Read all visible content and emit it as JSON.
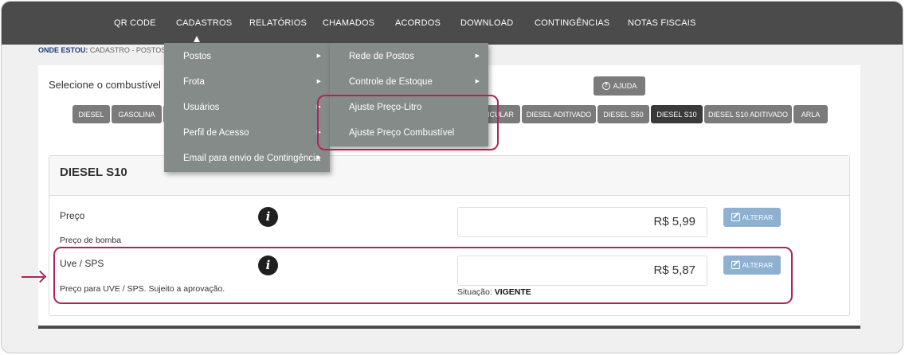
{
  "nav": {
    "items": [
      "QR CODE",
      "CADASTROS",
      "RELATÓRIOS",
      "CHAMADOS",
      "ACORDOS",
      "DOWNLOAD",
      "CONTINGÊNCIAS",
      "NOTAS FISCAIS"
    ]
  },
  "breadcrumb": {
    "label": "ONDE ESTOU:",
    "path": "CADASTRO - POSTOS"
  },
  "fuel_select": {
    "label": "Selecione o combustível c",
    "help_label": "AJUDA",
    "buttons": [
      "DIESEL",
      "GASOLINA",
      "",
      "ICULAR",
      "DIESEL ADITIVADO",
      "DIESEL S50",
      "DIESEL S10",
      "DIESEL S10 ADITIVADO",
      "ARLA"
    ],
    "selected": "DIESEL S10"
  },
  "card": {
    "title": "DIESEL S10",
    "rows": [
      {
        "label": "Preço",
        "description": "Preço de bomba",
        "value": "R$ 5,99",
        "button": "ALTERAR"
      },
      {
        "label": "Uve / SPS",
        "description": "Preço para UVE / SPS. Sujeito a aprovação.",
        "value": "R$ 5,87",
        "button": "ALTERAR"
      }
    ],
    "status_label": "Situação:",
    "status_value": "VIGENTE"
  },
  "menu_cadastros": {
    "items": [
      {
        "label": "Postos",
        "has_submenu": true
      },
      {
        "label": "Frota",
        "has_submenu": true
      },
      {
        "label": "Usuários",
        "has_submenu": true
      },
      {
        "label": "Perfil de Acesso",
        "has_submenu": true
      },
      {
        "label": "Email para envio de Contingência",
        "has_submenu": true
      }
    ]
  },
  "menu_postos": {
    "items": [
      {
        "label": "Rede de Postos",
        "has_submenu": true
      },
      {
        "label": "Controle de Estoque",
        "has_submenu": true
      },
      {
        "label": "Ajuste Preço-Litro",
        "has_submenu": false
      },
      {
        "label": "Ajuste Preço Combustível",
        "has_submenu": false
      }
    ]
  },
  "colors": {
    "nav_bg": "#4b4b4b",
    "menu_bg": "#858b88",
    "highlight": "#b0245e",
    "alter_button": "#8fb1d1",
    "active_fuel": "#3a3a3a"
  }
}
